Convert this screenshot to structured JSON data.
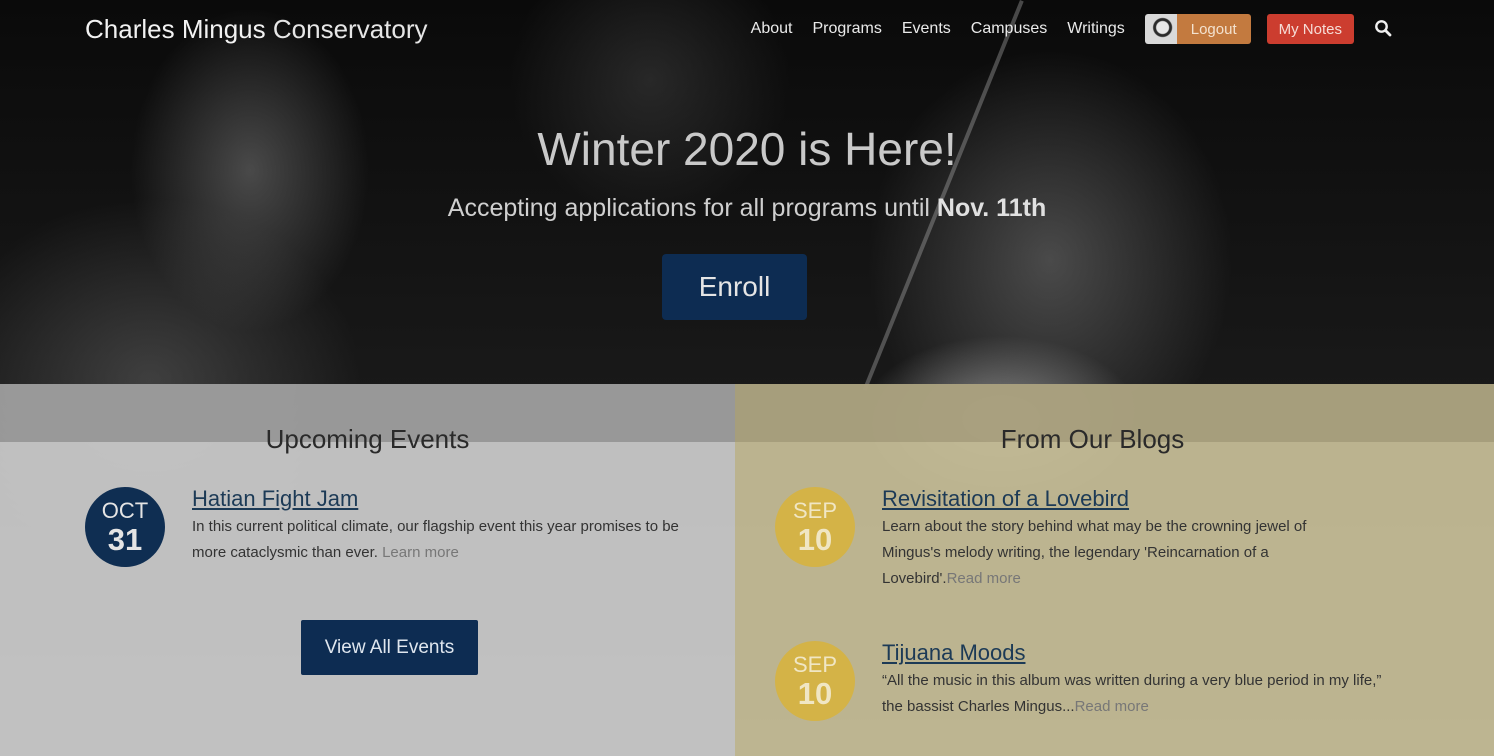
{
  "brand": {
    "part1": "Charles Mingus",
    "part2": "Conservatory"
  },
  "nav": {
    "links": [
      "About",
      "Programs",
      "Events",
      "Campuses",
      "Writings"
    ],
    "logout_label": "Logout",
    "notes_label": "My Notes",
    "search_icon": "search-icon"
  },
  "hero": {
    "title": "Winter 2020 is Here!",
    "subtitle_prefix": "Accepting applications for all programs until",
    "subtitle_date": "Nov. 11th",
    "enroll_label": "Enroll"
  },
  "events": {
    "heading": "Upcoming Events",
    "items": [
      {
        "month": "OCT",
        "day": "31",
        "title": "Hatian Fight Jam",
        "body": "In this current political climate, our flagship event this year promises to be more cataclysmic than ever.",
        "more": "Learn more"
      }
    ],
    "view_all_label": "View All Events"
  },
  "blogs": {
    "heading": "From Our Blogs",
    "items": [
      {
        "month": "SEP",
        "day": "10",
        "title": "Revisitation of a Lovebird",
        "body": "Learn about the story behind what may be the crowning jewel of Mingus's melody writing, the legendary 'Reincarnation of a Lovebird'.",
        "more": "Read more"
      },
      {
        "month": "SEP",
        "day": "10",
        "title": "Tijuana Moods",
        "body": "“All the music in this album was written during a very blue period in my life,” the bassist Charles Mingus...",
        "more": "Read more"
      }
    ]
  },
  "colors": {
    "navy": "#0d2c52",
    "gold_badge": "#d4b347",
    "logout_orange": "#c37a3f",
    "notes_red": "#cc3d2f"
  }
}
